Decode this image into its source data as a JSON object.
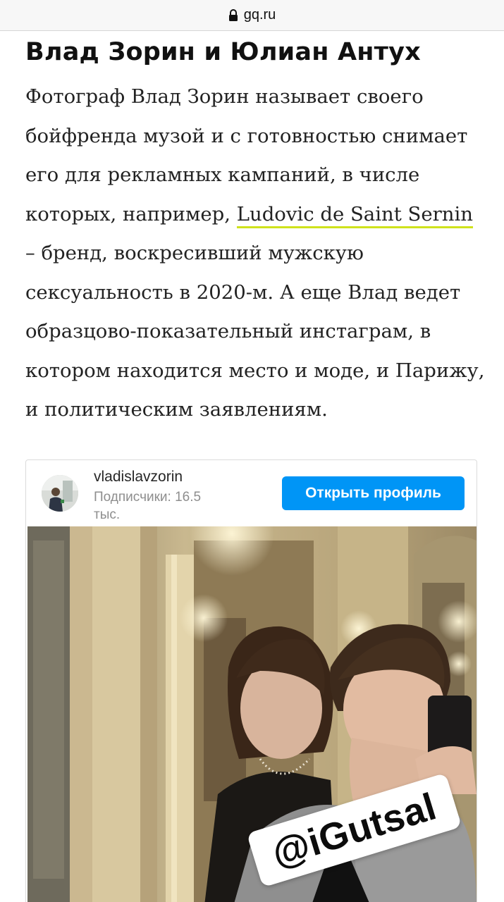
{
  "browser": {
    "url": "gq.ru",
    "icon": "lock-icon"
  },
  "article": {
    "headline": "Влад Зорин и Юлиан Антух",
    "lines": [
      "Фотограф Влад Зорин называет своего",
      "бойфренда музой и с готовностью снимает",
      "его для рекламных кампаний, в числе",
      "которых, например, ",
      "– бренд, воскресивший мужскую",
      "сексуальность в 2020-м. А еще Влад ведет",
      "образцово-показательный инстаграм, в",
      "котором находится место и моде, и Парижу,",
      "и политическим заявлениям."
    ],
    "link_text": "Ludovic de Saint Sernin",
    "link_underline_color": "#cfe21c"
  },
  "instagram_embed": {
    "username": "vladislavzorin",
    "followers_line1": "Подписчики: 16.5",
    "followers_line2": "тыс.",
    "open_profile_button": "Открыть профиль",
    "button_color": "#0095f6",
    "photo_watermark": "@iGutsal"
  }
}
